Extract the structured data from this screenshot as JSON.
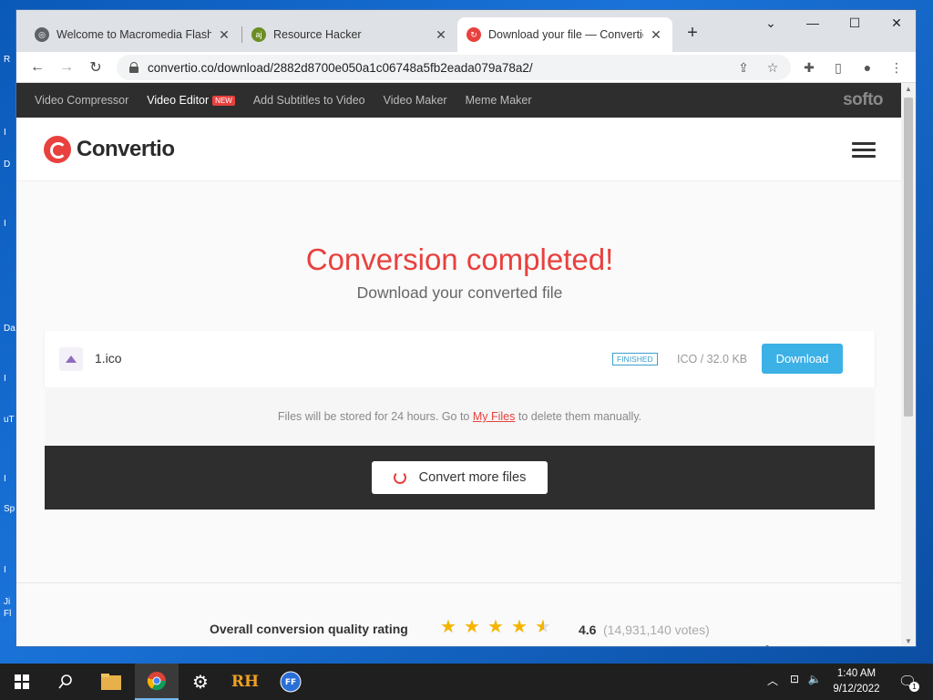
{
  "desktop": {
    "side_letters": [
      "R",
      "I",
      "D",
      "I",
      "Da",
      "I",
      "uT",
      "I",
      "Sp",
      "I",
      "Ji",
      "Fl"
    ]
  },
  "browser": {
    "tabs": [
      {
        "label": "Welcome to Macromedia Flash MX",
        "icon": "globe-icon"
      },
      {
        "label": "Resource Hacker",
        "icon": "resource-hacker-icon"
      },
      {
        "label": "Download your file — Convertio",
        "icon": "convertio-icon"
      }
    ],
    "url": "convertio.co/download/2882d8700e050a1c06748a5fb2eada079a78a2/"
  },
  "site": {
    "topnav": [
      {
        "label": "Video Compressor",
        "bright": false
      },
      {
        "label": "Video Editor",
        "bright": true,
        "badge": "NEW"
      },
      {
        "label": "Add Subtitles to Video",
        "bright": false
      },
      {
        "label": "Video Maker",
        "bright": false
      },
      {
        "label": "Meme Maker",
        "bright": false
      }
    ],
    "brand": "softo",
    "logo_text": "Convertio",
    "heading": "Conversion completed!",
    "subheading": "Download your converted file",
    "file": {
      "name": "1.ico",
      "status": "FINISHED",
      "info": "ICO / 32.0 KB",
      "download_label": "Download"
    },
    "note": {
      "prefix": "Files will be stored for 24 hours. Go to ",
      "link": "My Files",
      "suffix": " to delete them manually."
    },
    "convert_more_label": "Convert more files",
    "rating": {
      "label": "Overall conversion quality rating",
      "score": "4.6",
      "votes": "(14,931,140 votes)",
      "stars_value": 4.6
    }
  },
  "taskbar": {
    "time": "1:40 AM",
    "date": "9/12/2022",
    "notification_count": "1"
  },
  "colors": {
    "accent": "#e8413e",
    "download_button": "#3cb1e6"
  }
}
